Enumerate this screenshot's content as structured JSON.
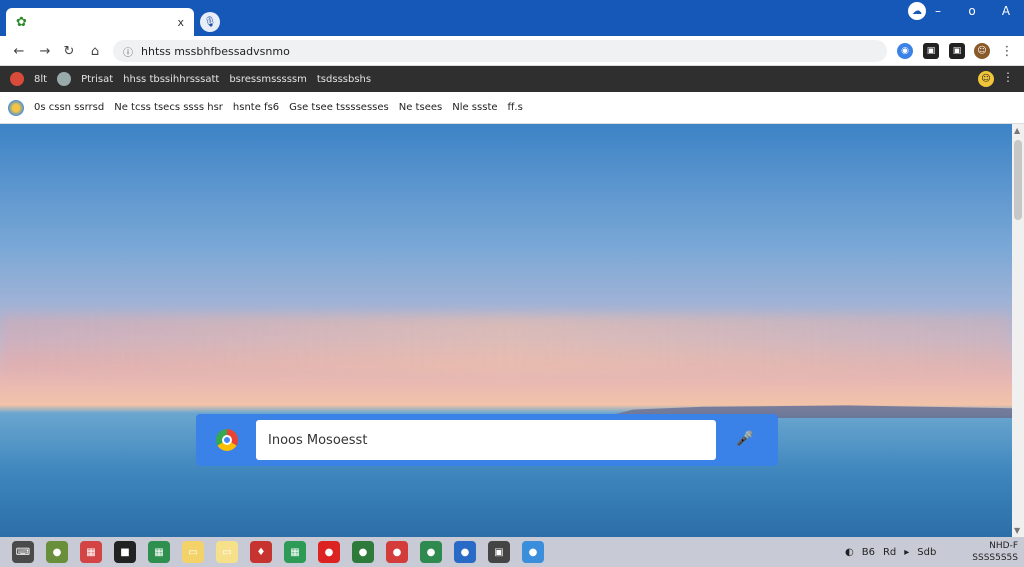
{
  "colors": {
    "titlebar": "#1558b8",
    "accent": "#3b82e8",
    "bookmarks_dark": "#2f2f2f",
    "taskbar": "#c8cbd6"
  },
  "tab": {
    "favicon": "leaf-icon",
    "close": "x"
  },
  "window_controls": {
    "minimize": "–",
    "maximize": "o",
    "close": "A"
  },
  "toolbar": {
    "back": "←",
    "forward": "→",
    "reload": "↻",
    "home": "⌂",
    "url": "hhtss mssbhfbessadvsnmo",
    "url_icon": "ⓘ",
    "extensions": [
      "◉",
      "▣",
      "▣",
      "☺"
    ],
    "menu": "⋮"
  },
  "bookmarks_dark": {
    "items": [
      "8lt",
      "Ptrisat",
      "hhss tbssihhrsssatt",
      "bsressmsssssm",
      "tsdsssbshs"
    ],
    "more": "⋮"
  },
  "bookmarks_light": {
    "items": [
      "0s cssn ssrrsd",
      "Ne tcss tsecs ssss hsr",
      "hsnte fs6",
      "Gse tsee tssssesses",
      "Ne tsees",
      "Nle ssste",
      "ff.s"
    ]
  },
  "search": {
    "value": "Inoos Mosoesst"
  },
  "taskbar": {
    "apps": [
      {
        "icon": "keyboard-icon",
        "glyph": "⌨",
        "color": "#4a4a4a"
      },
      {
        "icon": "globe-icon",
        "glyph": "●",
        "color": "#6a8f3a"
      },
      {
        "icon": "document-icon",
        "glyph": "▦",
        "color": "#d34444"
      },
      {
        "icon": "terminal-icon",
        "glyph": "■",
        "color": "#222222"
      },
      {
        "icon": "spreadsheet-icon",
        "glyph": "▦",
        "color": "#2f8f4f"
      },
      {
        "icon": "notes-icon",
        "glyph": "▭",
        "color": "#f3d26a"
      },
      {
        "icon": "sticky-icon",
        "glyph": "▭",
        "color": "#f7e08a"
      },
      {
        "icon": "game-icon",
        "glyph": "♦",
        "color": "#c7332e"
      },
      {
        "icon": "calculator-icon",
        "glyph": "▦",
        "color": "#2d9a56"
      },
      {
        "icon": "record-icon",
        "glyph": "●",
        "color": "#d22"
      },
      {
        "icon": "chrome-icon",
        "glyph": "●",
        "color": "#2d7a3a"
      },
      {
        "icon": "media-icon",
        "glyph": "●",
        "color": "#d43b3b"
      },
      {
        "icon": "network-icon",
        "glyph": "●",
        "color": "#2e8a4e"
      },
      {
        "icon": "browser-icon",
        "glyph": "●",
        "color": "#2a6ac7"
      },
      {
        "icon": "photo-icon",
        "glyph": "▣",
        "color": "#444444"
      },
      {
        "icon": "weather-icon",
        "glyph": "●",
        "color": "#3b8edb"
      }
    ],
    "tray": [
      "◐",
      "B6",
      "Rd",
      "▸",
      "Sdb"
    ],
    "clock_line1": "NHD-F",
    "clock_line2": "SSSS5S5S"
  }
}
